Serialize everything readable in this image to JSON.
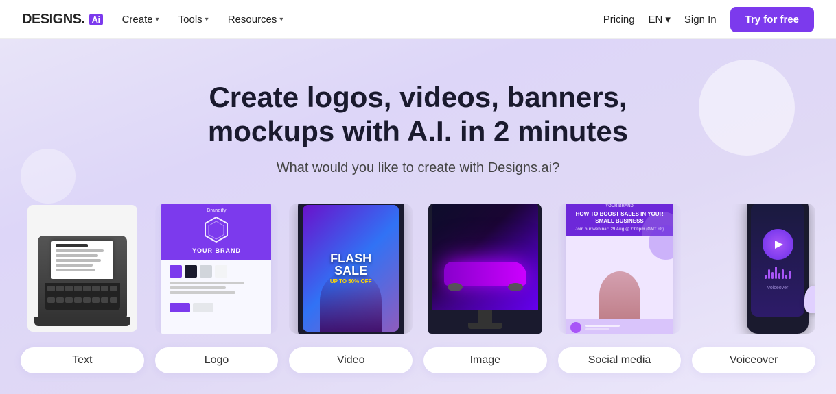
{
  "navbar": {
    "logo_text": "DESIGNS.",
    "logo_ai": "Ai",
    "nav_items": [
      {
        "label": "Create",
        "has_chevron": true
      },
      {
        "label": "Tools",
        "has_chevron": true
      },
      {
        "label": "Resources",
        "has_chevron": true
      }
    ],
    "pricing_label": "Pricing",
    "lang_label": "EN",
    "sign_in_label": "Sign In",
    "try_free_label": "Try for free"
  },
  "hero": {
    "title": "Create logos, videos, banners, mockups with A.I. in 2 minutes",
    "subtitle": "What would you like to create with Designs.ai?"
  },
  "cards": [
    {
      "id": "text",
      "label": "Text",
      "type": "typewriter"
    },
    {
      "id": "logo",
      "label": "Logo",
      "type": "logo",
      "header_text": "YOUR BRAND"
    },
    {
      "id": "video",
      "label": "Video",
      "type": "video",
      "flash_line1": "FLASH",
      "flash_line2": "SALE"
    },
    {
      "id": "image",
      "label": "Image",
      "type": "image"
    },
    {
      "id": "social",
      "label": "Social media",
      "type": "social",
      "title_text": "HOW TO BOOST SALES IN YOUR SMALL BUSINESS"
    },
    {
      "id": "voiceover",
      "label": "Voiceover",
      "type": "voiceover"
    }
  ],
  "colors": {
    "primary": "#7c3aed",
    "primary_dark": "#6d28d9",
    "background": "#e8e4f8",
    "white": "#ffffff"
  }
}
